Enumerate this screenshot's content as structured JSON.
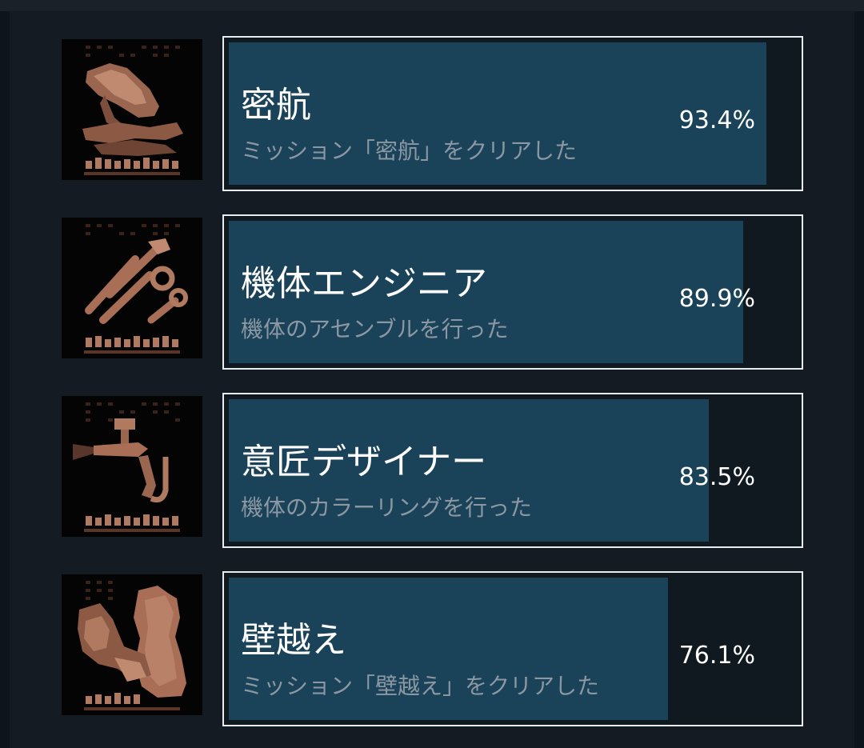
{
  "achievements": [
    {
      "title": "密航",
      "description": "ミッション「密航」をクリアした",
      "percent_label": "93.4%",
      "percent": 93.4,
      "icon": "stowaway-ship-icon"
    },
    {
      "title": "機体エンジニア",
      "description": "機体のアセンブルを行った",
      "percent_label": "89.9%",
      "percent": 89.9,
      "icon": "tools-wrench-icon"
    },
    {
      "title": "意匠デザイナー",
      "description": "機体のカラーリングを行った",
      "percent_label": "83.5%",
      "percent": 83.5,
      "icon": "spray-gun-icon"
    },
    {
      "title": "壁越え",
      "description": "ミッション「壁越え」をクリアした",
      "percent_label": "76.1%",
      "percent": 76.1,
      "icon": "wall-climb-icon"
    }
  ],
  "colors": {
    "background": "#0e141c",
    "panel": "#141b23",
    "progress_fill": "#1a4258",
    "border": "#e8ecef",
    "title_text": "#ffffff",
    "description_text": "#8b98a3",
    "icon_copper": "#b87860"
  }
}
